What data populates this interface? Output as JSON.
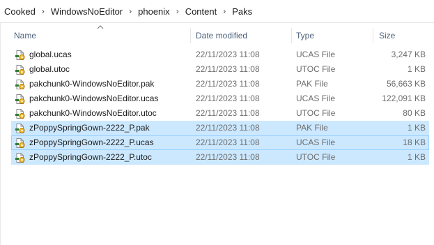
{
  "breadcrumb": [
    "Cooked",
    "WindowsNoEditor",
    "phoenix",
    "Content",
    "Paks"
  ],
  "columns": {
    "name": "Name",
    "date": "Date modified",
    "type": "Type",
    "size": "Size"
  },
  "files": [
    {
      "name": "global.ucas",
      "date": "22/11/2023 11:08",
      "type": "UCAS File",
      "size": "3,247 KB",
      "selected": false
    },
    {
      "name": "global.utoc",
      "date": "22/11/2023 11:08",
      "type": "UTOC File",
      "size": "1 KB",
      "selected": false
    },
    {
      "name": "pakchunk0-WindowsNoEditor.pak",
      "date": "22/11/2023 11:08",
      "type": "PAK File",
      "size": "56,663 KB",
      "selected": false
    },
    {
      "name": "pakchunk0-WindowsNoEditor.ucas",
      "date": "22/11/2023 11:08",
      "type": "UCAS File",
      "size": "122,091 KB",
      "selected": false
    },
    {
      "name": "pakchunk0-WindowsNoEditor.utoc",
      "date": "22/11/2023 11:08",
      "type": "UTOC File",
      "size": "80 KB",
      "selected": false
    },
    {
      "name": "zPoppySpringGown-2222_P.pak",
      "date": "22/11/2023 11:08",
      "type": "PAK File",
      "size": "1 KB",
      "selected": true
    },
    {
      "name": "zPoppySpringGown-2222_P.ucas",
      "date": "22/11/2023 11:08",
      "type": "UCAS File",
      "size": "18 KB",
      "selected": true,
      "focused": true
    },
    {
      "name": "zPoppySpringGown-2222_P.utoc",
      "date": "22/11/2023 11:08",
      "type": "UTOC File",
      "size": "1 KB",
      "selected": true
    }
  ],
  "icons": {
    "file": "file-with-gear-icon",
    "sort": "sort-ascending-icon",
    "separator": "chevron-right-icon"
  },
  "colors": {
    "selection": "#cce8ff",
    "focus_border": "#99d1ff",
    "header_text": "#4c607a",
    "secondary_text": "#6d6d6d"
  }
}
